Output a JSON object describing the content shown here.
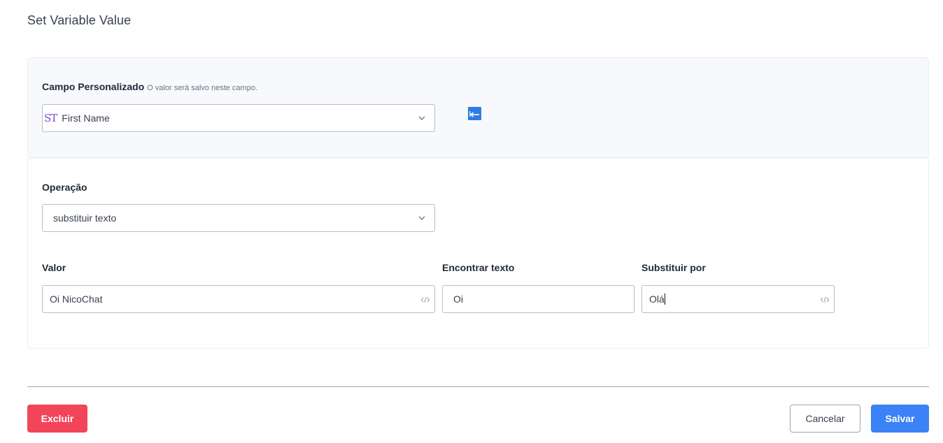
{
  "dialog": {
    "title": "Set Variable Value"
  },
  "custom_field": {
    "label": "Campo Personalizado",
    "hint": "O valor será salvo neste campo.",
    "type_icon": "ST",
    "selected": "First Name",
    "icon": "chevron-down-icon"
  },
  "operation": {
    "label": "Operação",
    "selected": "substituir texto"
  },
  "value_field": {
    "label": "Valor",
    "value": "Oi NicoChat"
  },
  "find_field": {
    "label": "Encontrar texto",
    "value": "Oi"
  },
  "replace_field": {
    "label": "Substituir por",
    "value": "Olá"
  },
  "footer": {
    "delete_label": "Excluir",
    "cancel_label": "Cancelar",
    "save_label": "Salvar"
  },
  "colors": {
    "primary": "#3b82f6",
    "danger": "#f2455a",
    "type_icon": "#7c4dcc"
  }
}
